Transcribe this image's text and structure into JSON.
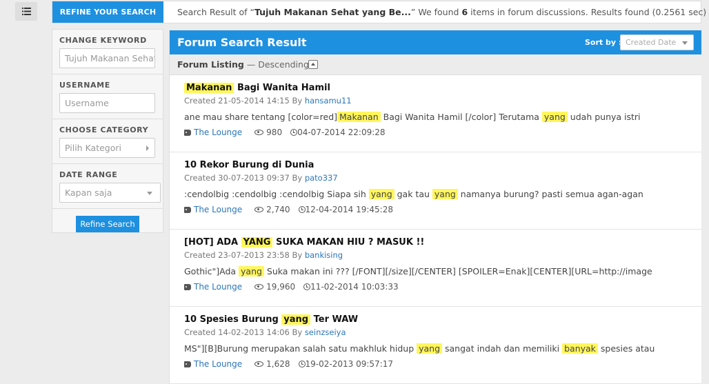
{
  "topbar": {
    "refine_tab": "REFINE YOUR SEARCH",
    "summary_prefix": "Search Result of “",
    "query": "Tujuh Makanan Sehat yang Be...",
    "summary_mid": "” We found ",
    "count": "6",
    "summary_suffix": " items in forum discussions. Results found (0.2561 sec)"
  },
  "sidebar": {
    "keyword_label": "CHANGE KEYWORD",
    "keyword_value": "Tujuh Makanan Sehat yang Be",
    "username_label": "USERNAME",
    "username_placeholder": "Username",
    "category_label": "CHOOSE CATEGORY",
    "category_value": "Pilih Kategori",
    "date_label": "DATE RANGE",
    "date_value": "Kapan saja",
    "refine_button": "Refine Search"
  },
  "main": {
    "title": "Forum Search Result",
    "sort_label": "Sort by :",
    "sort_value": "Created Date",
    "listing_label": "Forum Listing",
    "listing_order": " — Descending"
  },
  "results": [
    {
      "title_parts": [
        "",
        "Makanan",
        " Bagi Wanita Hamil"
      ],
      "created": "Created 21-05-2014 14:15 By ",
      "author": "hansamu11",
      "snippet_parts": [
        "ane mau share tentang [color=red]",
        "Makanan",
        " Bagi Wanita Hamil [/color] Terutama ",
        "yang",
        " udah punya istri"
      ],
      "category": "The Lounge",
      "views": "980",
      "last_post": "04-07-2014 22:09:28"
    },
    {
      "title_parts": [
        "10 Rekor Burung di Dunia"
      ],
      "created": "Created 30-07-2013 09:37 By ",
      "author": "pato337",
      "snippet_parts": [
        ":cendolbig :cendolbig :cendolbig Siapa sih ",
        "yang",
        " gak tau ",
        "yang",
        " namanya burung? pasti semua agan-agan"
      ],
      "category": "The Lounge",
      "views": "2,740",
      "last_post": "12-04-2014 19:45:28"
    },
    {
      "title_parts": [
        "[HOT] ADA ",
        "YANG",
        " SUKA MAKAN HIU ? MASUK !!"
      ],
      "created": "Created 23-07-2013 23:58 By ",
      "author": "bankising",
      "snippet_parts": [
        "Gothic\"]Ada ",
        "yang",
        " Suka makan ini ??? [/FONT][/size][/CENTER] [SPOILER=Enak][CENTER][URL=http://image"
      ],
      "category": "The Lounge",
      "views": "19,960",
      "last_post": "11-02-2014 10:03:33"
    },
    {
      "title_parts": [
        "10 Spesies Burung ",
        "yang",
        " Ter WAW"
      ],
      "created": "Created 14-02-2013 14:06 By ",
      "author": "seinzseiya",
      "snippet_parts": [
        "MS\"][B]Burung merupakan salah satu makhluk hidup ",
        "yang",
        " sangat indah dan memiliki ",
        "banyak",
        " spesies atau"
      ],
      "category": "The Lounge",
      "views": "1,628",
      "last_post": "19-02-2013 09:57:17"
    }
  ],
  "icons": {
    "menu": "list-menu-icon",
    "tag": "tag-icon",
    "views": "eye-icon",
    "time": "clock-icon"
  },
  "colors": {
    "accent": "#1e90e0",
    "highlight": "#fff65b",
    "link": "#2a76b9"
  }
}
